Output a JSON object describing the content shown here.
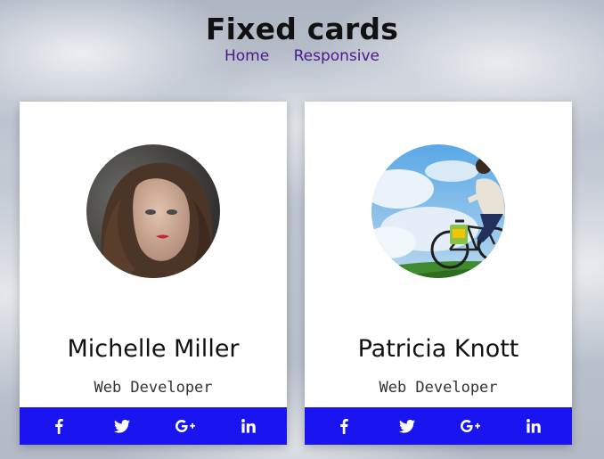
{
  "header": {
    "title": "Fixed cards",
    "nav": [
      {
        "label": "Home"
      },
      {
        "label": "Responsive"
      }
    ]
  },
  "cards": [
    {
      "name": "Michelle Miller",
      "role": "Web Developer",
      "photo": "woman-portrait-photo",
      "social": [
        "facebook-icon",
        "twitter-icon",
        "google-plus-icon",
        "linkedin-icon"
      ]
    },
    {
      "name": "Patricia Knott",
      "role": "Web Developer",
      "photo": "bicycle-rider-photo",
      "social": [
        "facebook-icon",
        "twitter-icon",
        "google-plus-icon",
        "linkedin-icon"
      ]
    }
  ],
  "colors": {
    "social_bar": "#1a14f0",
    "nav_link": "#4a1a8c",
    "card_bg": "#ffffff"
  }
}
